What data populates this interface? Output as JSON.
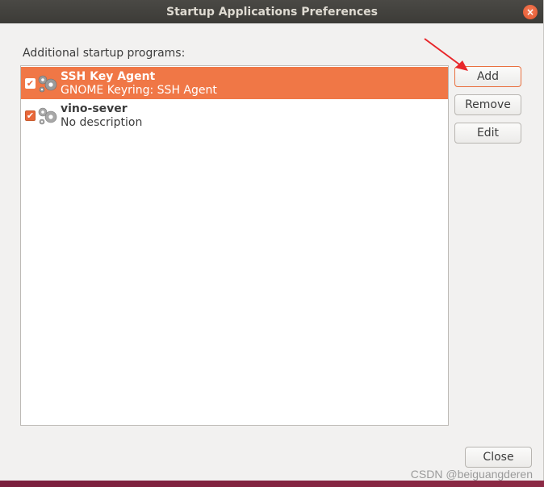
{
  "window": {
    "title": "Startup Applications Preferences",
    "close_glyph": "×"
  },
  "list_label": "Additional startup programs:",
  "programs": [
    {
      "name": "SSH Key Agent",
      "description": "GNOME Keyring: SSH Agent",
      "enabled": true,
      "selected": true,
      "icon": "gear-icon"
    },
    {
      "name": "vino-sever",
      "description": "No description",
      "enabled": true,
      "selected": false,
      "icon": "gear-icon"
    }
  ],
  "buttons": {
    "add": "Add",
    "remove": "Remove",
    "edit": "Edit",
    "close": "Close"
  },
  "watermark": "CSDN @beiguangderen",
  "colors": {
    "accent": "#f07746",
    "titlebar": "#3c3b37",
    "annotation_arrow": "#e8262a"
  }
}
